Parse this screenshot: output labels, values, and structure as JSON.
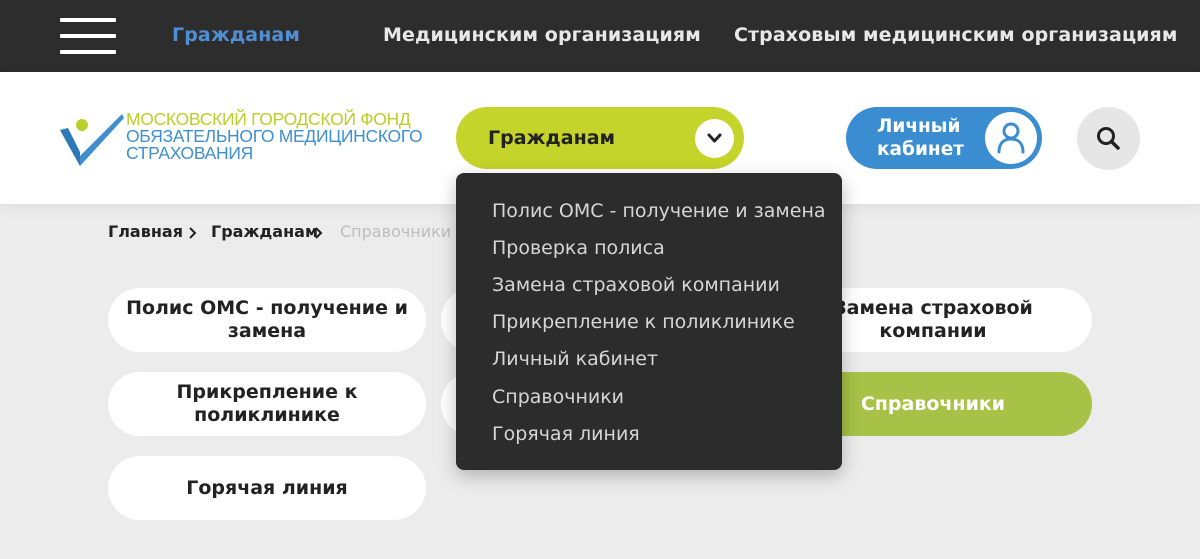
{
  "topnav": {
    "items": [
      {
        "label": "Гражданам",
        "active": true
      },
      {
        "label": "Медицинским организациям",
        "active": false
      },
      {
        "label": "Страховым медицинским организациям",
        "active": false
      }
    ]
  },
  "logo": {
    "line1": "Московский городской фонд",
    "line2": "обязательного медицинского",
    "line3": "страхования"
  },
  "header": {
    "section_selected": "Гражданам",
    "cabinet_label": "Личный кабинет"
  },
  "breadcrumb": {
    "items": [
      "Главная",
      "Гражданам",
      "Справочники"
    ]
  },
  "cards": [
    {
      "label": "Полис ОМС - получение и замена",
      "active": false
    },
    {
      "label": "",
      "active": false
    },
    {
      "label": "Замена страховой компании",
      "active": false
    },
    {
      "label": "Прикрепление к поликлинике",
      "active": false
    },
    {
      "label": "",
      "active": false
    },
    {
      "label": "Справочники",
      "active": true
    },
    {
      "label": "Горячая линия",
      "active": false
    }
  ],
  "dropdown": {
    "items": [
      "Полис ОМС - получение и замена",
      "Проверка полиса",
      "Замена страховой компании",
      "Прикрепление к поликлинике",
      "Личный кабинет",
      "Справочники",
      "Горячая линия"
    ]
  },
  "colors": {
    "topbar": "#2d2d2d",
    "active_link": "#4f8fd6",
    "lime": "#c4d42a",
    "blue": "#3a8dd0",
    "green_card": "#a7c247",
    "dropdown_bg": "#2c2c2c"
  },
  "icons": {
    "menu": "hamburger-icon",
    "chevron": "chevron-down-icon",
    "user": "user-icon",
    "search": "search-icon",
    "separator": "chevron-right-icon"
  }
}
